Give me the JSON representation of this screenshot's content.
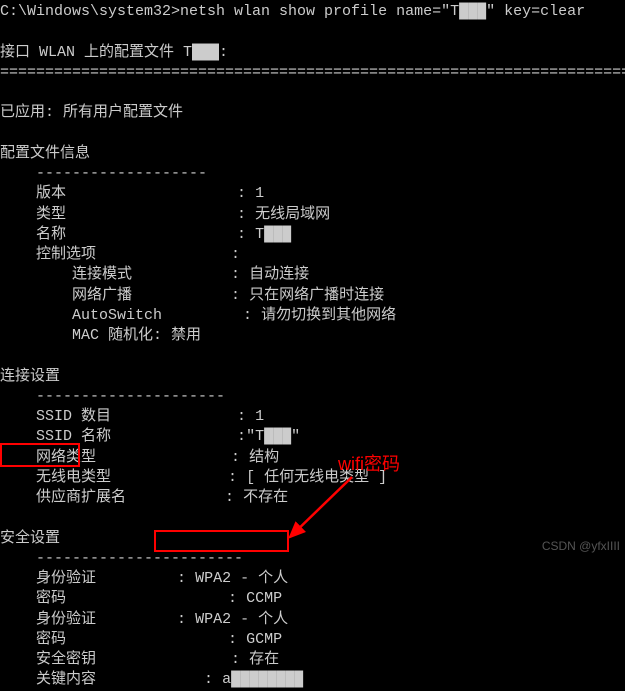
{
  "prompt": {
    "path": "C:\\Windows\\system32>",
    "command": "netsh wlan show profile name=\"T███\" key=clear"
  },
  "interface_line": "接口 WLAN 上的配置文件 T███:",
  "divider": "=======================================================================",
  "applied": "已应用: 所有用户配置文件",
  "sections": {
    "profile_info": {
      "title": "配置文件信息",
      "dash": "-------------------",
      "rows": {
        "version": {
          "label": "版本",
          "value": "1"
        },
        "type": {
          "label": "类型",
          "value": "无线局域网"
        },
        "name": {
          "label": "名称",
          "value": "T███"
        },
        "ctrl_opt": {
          "label": "控制选项",
          "value": ""
        },
        "conn_mode": {
          "label": "连接模式",
          "value": "自动连接"
        },
        "broadcast": {
          "label": "网络广播",
          "value": "只在网络广播时连接"
        },
        "autoswitch": {
          "label": "AutoSwitch",
          "value": "请勿切换到其他网络"
        },
        "mac": {
          "label": "MAC 随机化: 禁用",
          "value": ""
        }
      }
    },
    "connection": {
      "title": "连接设置",
      "dash": "---------------------",
      "rows": {
        "ssid_count": {
          "label": "SSID 数目",
          "value": "1"
        },
        "ssid_name": {
          "label": "SSID 名称",
          "value": "\"T███\""
        },
        "net_type": {
          "label": "网络类型",
          "value": "结构"
        },
        "radio_type": {
          "label": "无线电类型",
          "value": "[ 任何无线电类型 ]"
        },
        "vendor": {
          "label": "供应商扩展名",
          "value": "不存在"
        }
      }
    },
    "security": {
      "title": "安全设置",
      "dash": "-----------------------",
      "rows": {
        "auth1": {
          "label": "身份验证",
          "value": "WPA2 - 个人"
        },
        "cipher1": {
          "label": "密码",
          "value": "CCMP"
        },
        "auth2": {
          "label": "身份验证",
          "value": "WPA2 - 个人"
        },
        "cipher2": {
          "label": "密码",
          "value": "GCMP"
        },
        "seckey": {
          "label": "安全密钥",
          "value": "存在"
        },
        "keycontent": {
          "label": "关键内容",
          "value": "a████████"
        }
      }
    }
  },
  "annotation": {
    "wifi_password_label": "wifi密码"
  },
  "watermark": "CSDN @yfxIIII"
}
